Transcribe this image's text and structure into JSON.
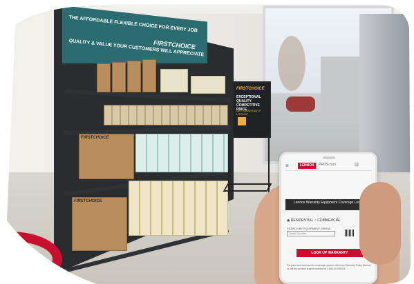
{
  "header": {
    "tagline": "THE AFFORDABLE FLEXIBLE CHOICE FOR EVERY JOB",
    "subline": "QUALITY & VALUE YOUR CUSTOMERS WILL APPRECIATE",
    "brand": "FIRSTCHOICE"
  },
  "boxes": {
    "label": "FIRSTCHOICE"
  },
  "sign": {
    "brand": "FIRSTCHOICE",
    "headline": "EXCEPTIONAL QUALITY COMPETITIVE PRICE",
    "small": "GET A WARRANTY LOOKUP"
  },
  "phone": {
    "brand": "LENNOX",
    "url": "PROS.com",
    "banner": "Lennox Warranty Equipment Coverage Lookup",
    "option1": "RESIDENTIAL",
    "option2": "COMMERCIAL",
    "field_label": "SEARCH BY EQUIPMENT SERIAL",
    "field_placeholder": "Serial Number",
    "button": "LOOK UP WARRANTY",
    "note": "For parts and accessories coverage, please reference Warranty Policy Manual or call the product support number at 1-800-4LENNOX."
  },
  "colors": {
    "teal": "#2b6c71",
    "lennox_red": "#c8102e",
    "sign_gold": "#f2b134"
  }
}
